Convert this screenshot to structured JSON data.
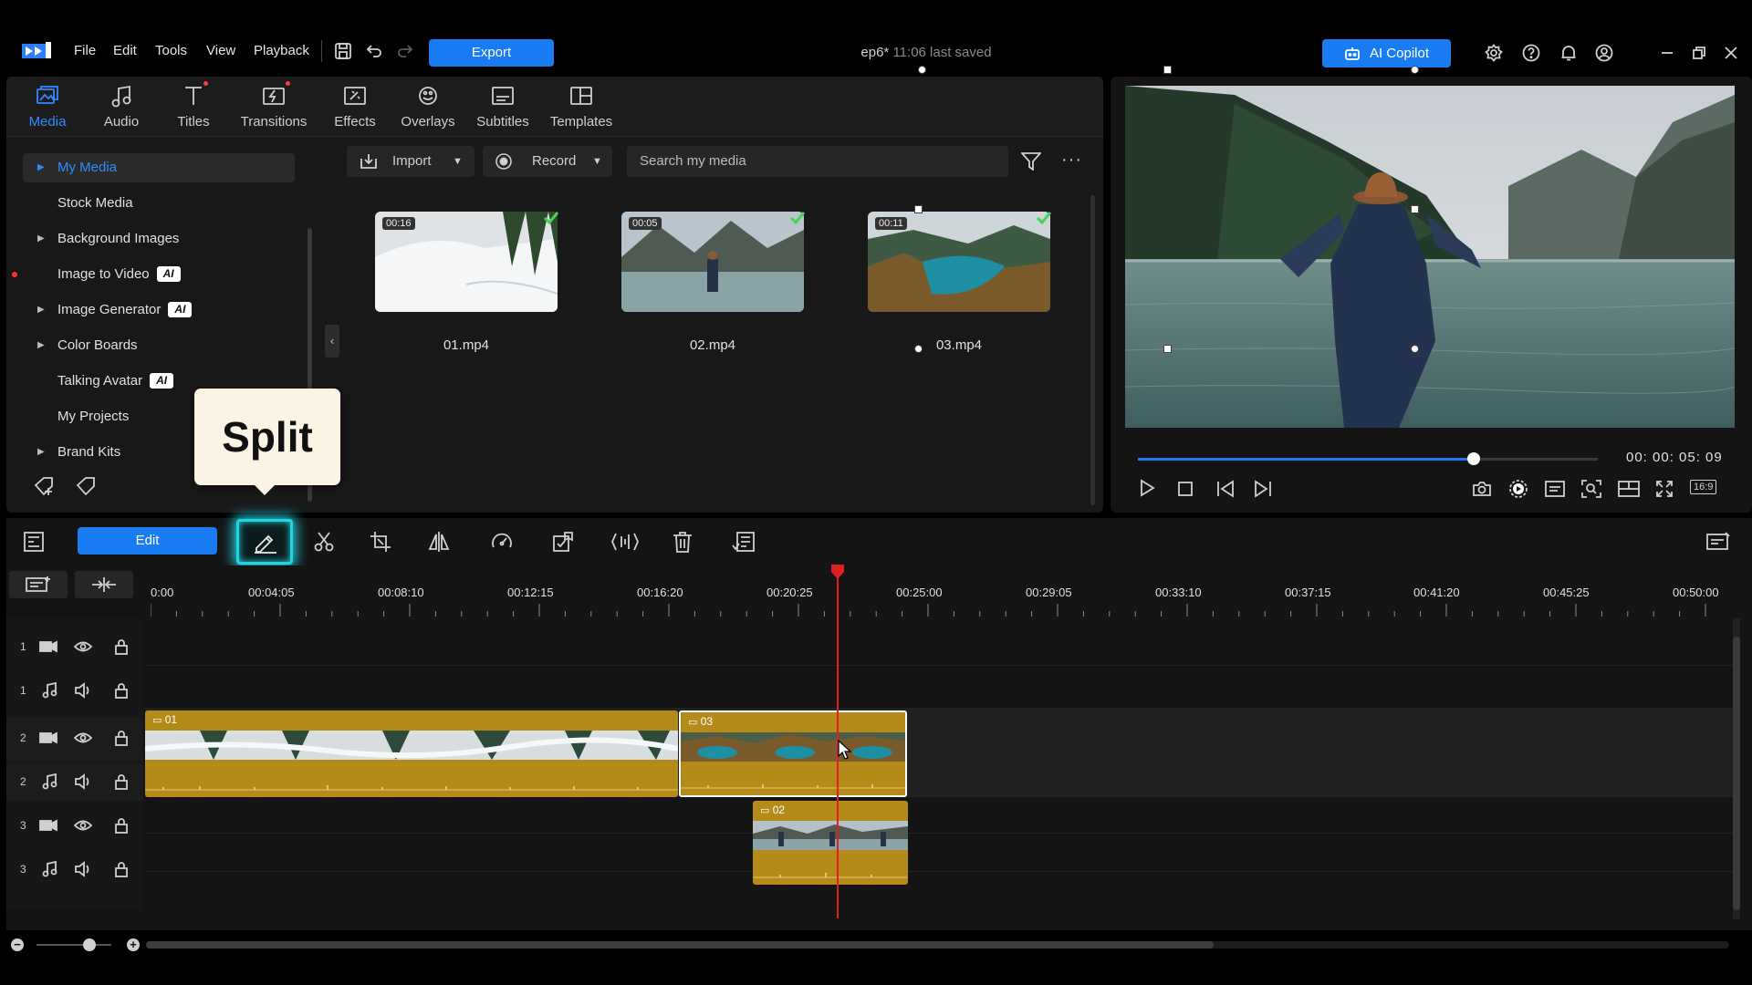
{
  "menubar": {
    "items": [
      "File",
      "Edit",
      "Tools",
      "View",
      "Playback"
    ],
    "export_label": "Export",
    "project_name": "ep6*",
    "saved_text": "11:06 last saved",
    "copilot_label": "AI Copilot"
  },
  "library": {
    "tabs": [
      {
        "label": "Media",
        "icon": "media-icon",
        "active": true
      },
      {
        "label": "Audio",
        "icon": "audio-icon"
      },
      {
        "label": "Titles",
        "icon": "titles-icon",
        "dot": true
      },
      {
        "label": "Transitions",
        "icon": "transitions-icon",
        "dot": true
      },
      {
        "label": "Effects",
        "icon": "effects-icon"
      },
      {
        "label": "Overlays",
        "icon": "overlays-icon"
      },
      {
        "label": "Subtitles",
        "icon": "subtitles-icon"
      },
      {
        "label": "Templates",
        "icon": "templates-icon"
      }
    ],
    "sidebar": [
      {
        "label": "My Media",
        "expandable": true,
        "selected": true
      },
      {
        "label": "Stock Media"
      },
      {
        "label": "Background Images",
        "expandable": true
      },
      {
        "label": "Image to Video",
        "ai": true,
        "new_dot": true
      },
      {
        "label": "Image Generator",
        "expandable": true,
        "ai": true
      },
      {
        "label": "Color Boards",
        "expandable": true
      },
      {
        "label": "Talking Avatar",
        "ai": true
      },
      {
        "label": "My Projects"
      },
      {
        "label": "Brand Kits",
        "expandable": true
      }
    ],
    "ai_badge": "AI",
    "import_label": "Import",
    "record_label": "Record",
    "search_placeholder": "Search my media",
    "media": [
      {
        "name": "01.mp4",
        "duration": "00:16"
      },
      {
        "name": "02.mp4",
        "duration": "00:05"
      },
      {
        "name": "03.mp4",
        "duration": "00:11"
      }
    ]
  },
  "tooltip": {
    "text": "Split"
  },
  "preview": {
    "timecode": "00: 00: 05: 09",
    "aspect": "16:9",
    "progress": 0.73
  },
  "toolbar": {
    "edit_label": "Edit"
  },
  "timeline": {
    "ruler": [
      "0:00",
      "00:04:05",
      "00:08:10",
      "00:12:15",
      "00:16:20",
      "00:20:25",
      "00:25:00",
      "00:29:05",
      "00:33:10",
      "00:37:15",
      "00:41:20",
      "00:45:25",
      "00:50:00"
    ],
    "tracks": [
      "1",
      "1",
      "2",
      "2",
      "3",
      "3"
    ],
    "clips": [
      {
        "title": "01"
      },
      {
        "title": "03"
      },
      {
        "title": "02"
      }
    ]
  },
  "colors": {
    "accent": "#1a7cf2",
    "clip": "#b48a18",
    "highlight": "#23d3e0",
    "playhead": "#e02020"
  }
}
